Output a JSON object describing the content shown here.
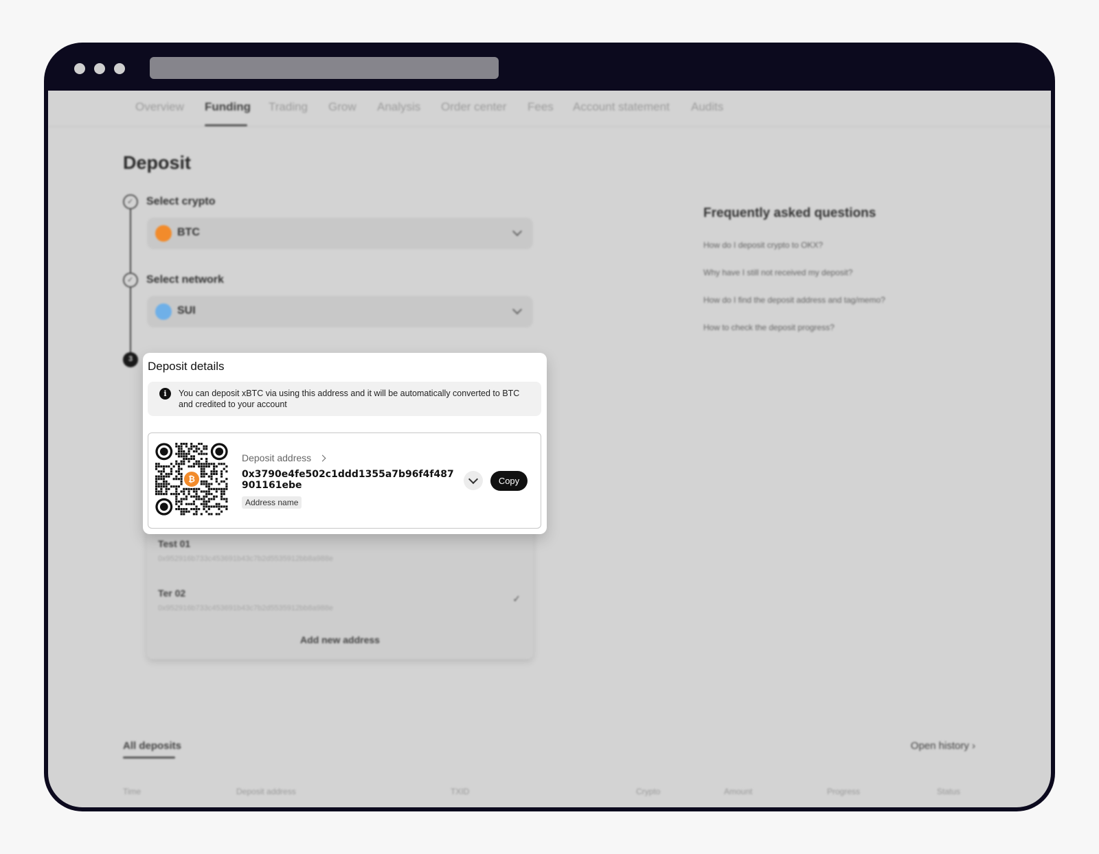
{
  "nav": {
    "tabs": [
      {
        "label": "Overview"
      },
      {
        "label": "Funding"
      },
      {
        "label": "Trading"
      },
      {
        "label": "Grow"
      },
      {
        "label": "Analysis"
      },
      {
        "label": "Order center"
      },
      {
        "label": "Fees"
      },
      {
        "label": "Account statement"
      },
      {
        "label": "Audits"
      }
    ],
    "active": "Funding"
  },
  "deposit": {
    "title": "Deposit",
    "step1_label": "Select crypto",
    "crypto_value": "BTC",
    "step2_label": "Select network",
    "network_value": "SUI",
    "step3_number": "3"
  },
  "faq": {
    "title": "Frequently asked questions",
    "items": [
      "How do I deposit crypto to OKX?",
      "Why have I still not received my deposit?",
      "How do I find the deposit address and tag/memo?",
      "How to check the deposit progress?"
    ]
  },
  "modal": {
    "title": "Deposit details",
    "notice": "You can deposit xBTC via using this address and it will be automatically converted to BTC and credited to your account",
    "address_label": "Deposit address",
    "address_value": "0x3790e4fe502c1ddd1355a7b96f4f487901161ebe",
    "address_name_tag": "Address name",
    "copy_label": "Copy",
    "qr_badge": "₿"
  },
  "address_list": {
    "items": [
      {
        "name": "Test 01",
        "hash": "0x952916b733c453691b43c7b2d5535912bb8a988e"
      },
      {
        "name": "Ter  02",
        "hash": "0x952916b733c453691b43c7b2d5535912bb8a988e"
      }
    ],
    "add_new_label": "Add new address"
  },
  "history": {
    "tab_label": "All deposits",
    "open_history_label": "Open history ›",
    "columns": [
      "Time",
      "Deposit address",
      "TXID",
      "Crypto",
      "Amount",
      "Progress",
      "Status"
    ]
  },
  "colors": {
    "btc": "#f28b2b",
    "sui": "#6fb0e8",
    "frame": "#0c0a1e"
  },
  "icons": {
    "info": "info-icon",
    "chevron": "chevron-down-icon",
    "check": "check-icon"
  }
}
